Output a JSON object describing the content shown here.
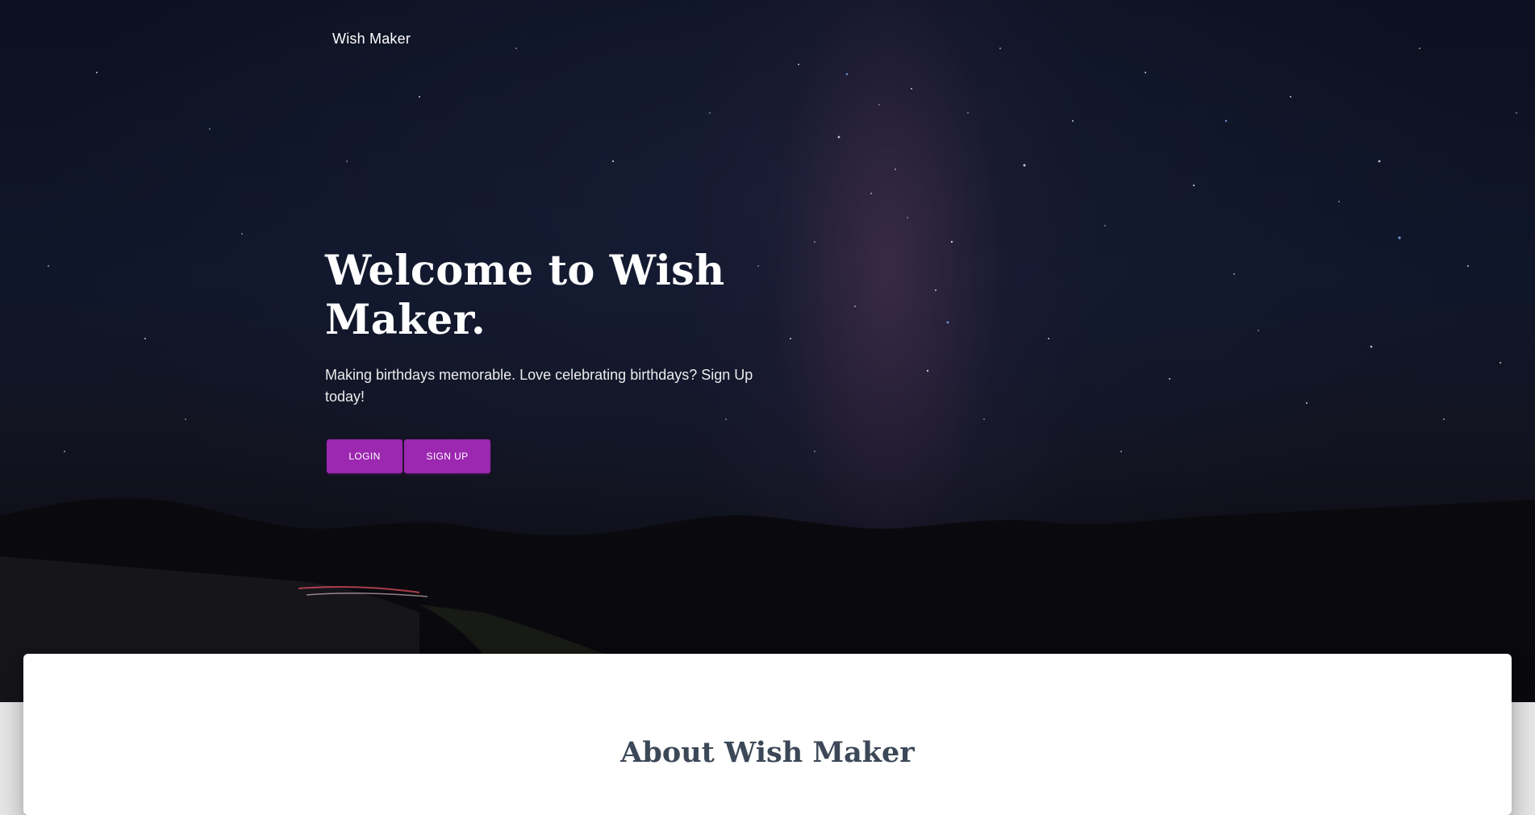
{
  "navbar": {
    "brand": "Wish Maker"
  },
  "hero": {
    "title": "Welcome to Wish Maker.",
    "subtitle": "Making birthdays memorable. Love celebrating birthdays? Sign Up today!",
    "buttons": {
      "login_label": "LOGIN",
      "signup_label": "SIGN UP"
    },
    "background": "night-sky-milky-way-image"
  },
  "about": {
    "title": "About Wish Maker"
  },
  "colors": {
    "accent": "#9c27b0",
    "heading_dark": "#3c4858",
    "page_background": "#e5e5e5"
  }
}
